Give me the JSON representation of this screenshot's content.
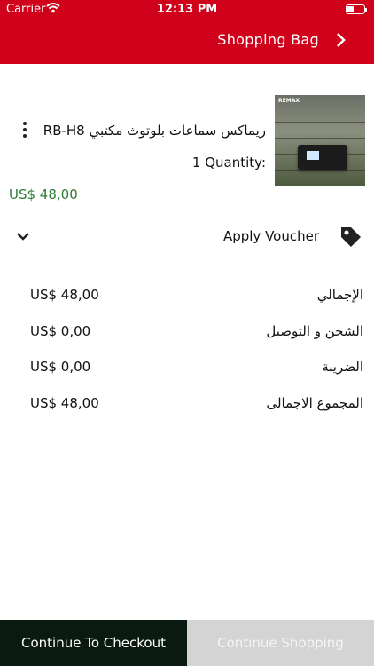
{
  "status_bar": {
    "carrier": "Carrier",
    "time": "12:13 PM"
  },
  "header": {
    "title": "Shopping Bag"
  },
  "cart_item": {
    "name": "ريماكس سماعات بلوتوث مكتبي RB-H8",
    "quantity": "1 Quantity:",
    "price": "US$ 48,00",
    "image_brand": "REMAX"
  },
  "voucher": {
    "label": "Apply Voucher"
  },
  "summary": [
    {
      "label": "الإجمالي",
      "amount": "US$ 48,00"
    },
    {
      "label": "الشحن و التوصيل",
      "amount": "US$ 0,00"
    },
    {
      "label": "الضريبة",
      "amount": "US$ 0,00"
    },
    {
      "label": "المجموع الاجمالى",
      "amount": "US$ 48,00"
    }
  ],
  "footer": {
    "checkout_label": "Continue To Checkout",
    "continue_label": "Continue Shopping"
  },
  "colors": {
    "header_bg": "#d0021b",
    "price_green": "#2e7d32",
    "checkout_bg": "#0b1a10",
    "continue_bg": "#d4d4d4"
  },
  "icons": {
    "wifi": "wifi-icon",
    "battery": "battery-icon",
    "nav_forward": "chevron-right-icon",
    "item_menu": "more-vertical-icon",
    "voucher_toggle": "chevron-down-icon",
    "voucher": "tag-icon"
  }
}
